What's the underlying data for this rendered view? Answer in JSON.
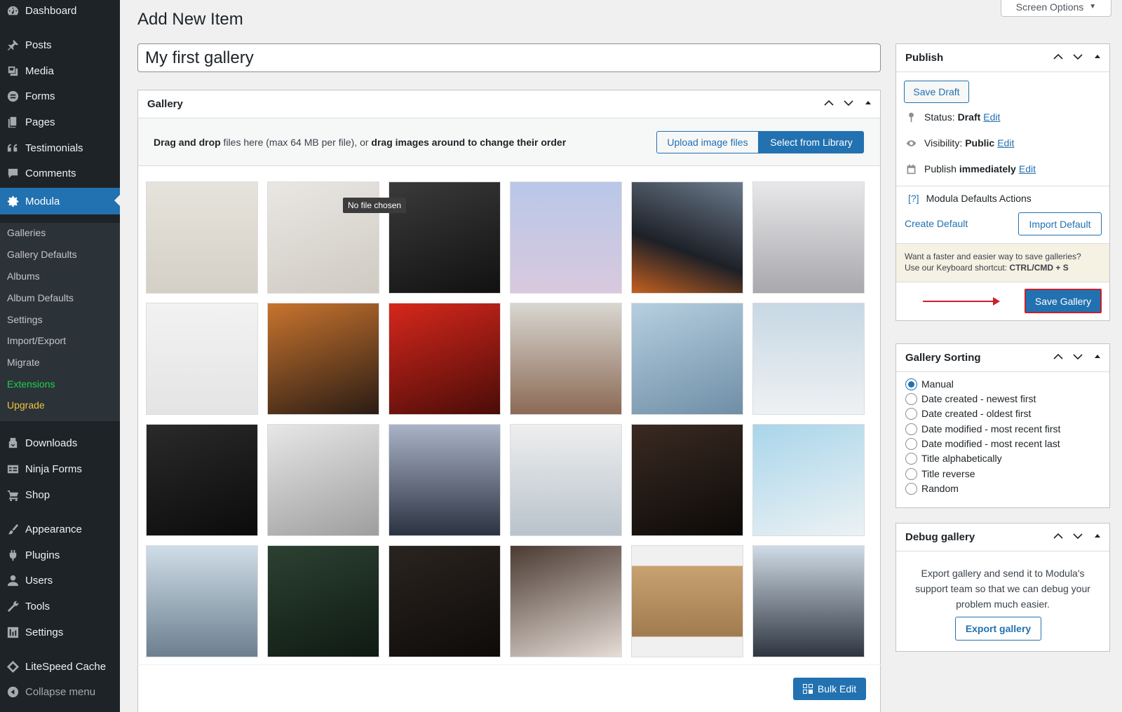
{
  "sidebar": {
    "items": [
      {
        "label": "Dashboard",
        "icon": "dashboard-icon"
      },
      {
        "label": "Posts",
        "icon": "pin-icon"
      },
      {
        "label": "Media",
        "icon": "media-icon"
      },
      {
        "label": "Forms",
        "icon": "forms-icon"
      },
      {
        "label": "Pages",
        "icon": "pages-icon"
      },
      {
        "label": "Testimonials",
        "icon": "quote-icon"
      },
      {
        "label": "Comments",
        "icon": "comment-icon"
      },
      {
        "label": "Modula",
        "icon": "gear-icon"
      },
      {
        "label": "Downloads",
        "icon": "download-icon"
      },
      {
        "label": "Ninja Forms",
        "icon": "table-icon"
      },
      {
        "label": "Shop",
        "icon": "cart-icon"
      },
      {
        "label": "Appearance",
        "icon": "brush-icon"
      },
      {
        "label": "Plugins",
        "icon": "plugin-icon"
      },
      {
        "label": "Users",
        "icon": "user-icon"
      },
      {
        "label": "Tools",
        "icon": "wrench-icon"
      },
      {
        "label": "Settings",
        "icon": "settings-icon"
      },
      {
        "label": "LiteSpeed Cache",
        "icon": "diamond-icon"
      },
      {
        "label": "Collapse menu",
        "icon": "collapse-icon"
      }
    ],
    "submenu": [
      "Galleries",
      "Gallery Defaults",
      "Albums",
      "Album Defaults",
      "Settings",
      "Import/Export",
      "Migrate",
      "Extensions",
      "Upgrade"
    ]
  },
  "header": {
    "title": "Add New Item",
    "screen_options": "Screen Options",
    "post_title_value": "My first gallery"
  },
  "gallery": {
    "title": "Gallery",
    "drop_bold_1": "Drag and drop",
    "drop_text_1": " files here (max 64 MB per file), or ",
    "drop_bold_2": "drag images around to change their order",
    "upload_button": "Upload image files",
    "library_button": "Select from Library",
    "tooltip": "No file chosen",
    "bulk_edit": "Bulk Edit"
  },
  "publish": {
    "title": "Publish",
    "save_draft": "Save Draft",
    "status_label": "Status:",
    "status_value": "Draft",
    "visibility_label": "Visibility:",
    "visibility_value": "Public",
    "publish_label": "Publish",
    "publish_value": "immediately",
    "edit": "Edit",
    "defaults_help": "[?]",
    "defaults_actions": "Modula Defaults Actions",
    "create_default": "Create Default",
    "import_default": "Import Default",
    "kbd_line1": "Want a faster and easier way to save galleries?",
    "kbd_line2": "Use our Keyboard shortcut:",
    "kbd_shortcut": "CTRL/CMD + S",
    "save_gallery": "Save Gallery"
  },
  "sorting": {
    "title": "Gallery Sorting",
    "options": [
      "Manual",
      "Date created - newest first",
      "Date created - oldest first",
      "Date modified - most recent first",
      "Date modified - most recent last",
      "Title alphabetically",
      "Title reverse",
      "Random"
    ],
    "selected": "Manual"
  },
  "debug": {
    "title": "Debug gallery",
    "text": "Export gallery and send it to Modula's support team so that we can debug your problem much easier.",
    "export_button": "Export gallery"
  },
  "colors": {
    "sidebar_bg": "#1d2327",
    "accent": "#2271b1",
    "highlight_red": "#c8202c",
    "extensions_green": "#1ed14b",
    "upgrade_yellow": "#f0c33c"
  }
}
